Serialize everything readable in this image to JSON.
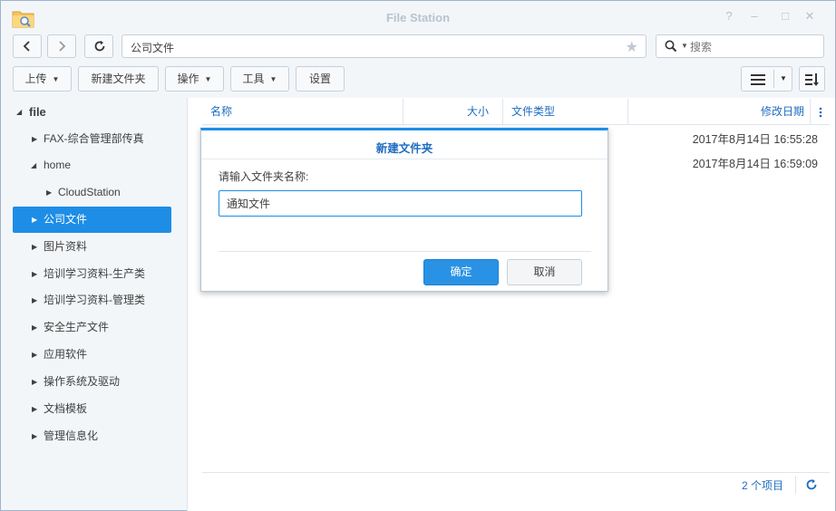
{
  "window": {
    "title": "File Station",
    "app_icon": "folder-search-icon",
    "controls": [
      "?",
      "–",
      "□",
      "✕"
    ]
  },
  "nav": {
    "path": "公司文件",
    "search_placeholder": "搜索"
  },
  "toolbar": {
    "upload": "上传",
    "new_folder": "新建文件夹",
    "action": "操作",
    "tools": "工具",
    "settings": "设置"
  },
  "sidebar": {
    "root": "file",
    "items": [
      {
        "label": "FAX-综合管理部传真"
      },
      {
        "label": "home"
      },
      {
        "label": "CloudStation"
      },
      {
        "label": "公司文件"
      },
      {
        "label": "图片资料"
      },
      {
        "label": "培训学习资料-生产类"
      },
      {
        "label": "培训学习资料-管理类"
      },
      {
        "label": "安全生产文件"
      },
      {
        "label": "应用软件"
      },
      {
        "label": "操作系统及驱动"
      },
      {
        "label": "文档模板"
      },
      {
        "label": "管理信息化"
      }
    ]
  },
  "table": {
    "columns": {
      "name": "名称",
      "size": "大小",
      "type": "文件类型",
      "modified": "修改日期"
    },
    "rows": [
      {
        "modified": "2017年8月14日 16:55:28"
      },
      {
        "modified": "2017年8月14日 16:59:09"
      }
    ]
  },
  "footer": {
    "count": "2 个项目"
  },
  "dialog": {
    "title": "新建文件夹",
    "prompt": "请输入文件夹名称:",
    "value": "通知文件",
    "ok": "确定",
    "cancel": "取消"
  },
  "colors": {
    "accent": "#1e8de6",
    "link": "#1f6cc0"
  }
}
